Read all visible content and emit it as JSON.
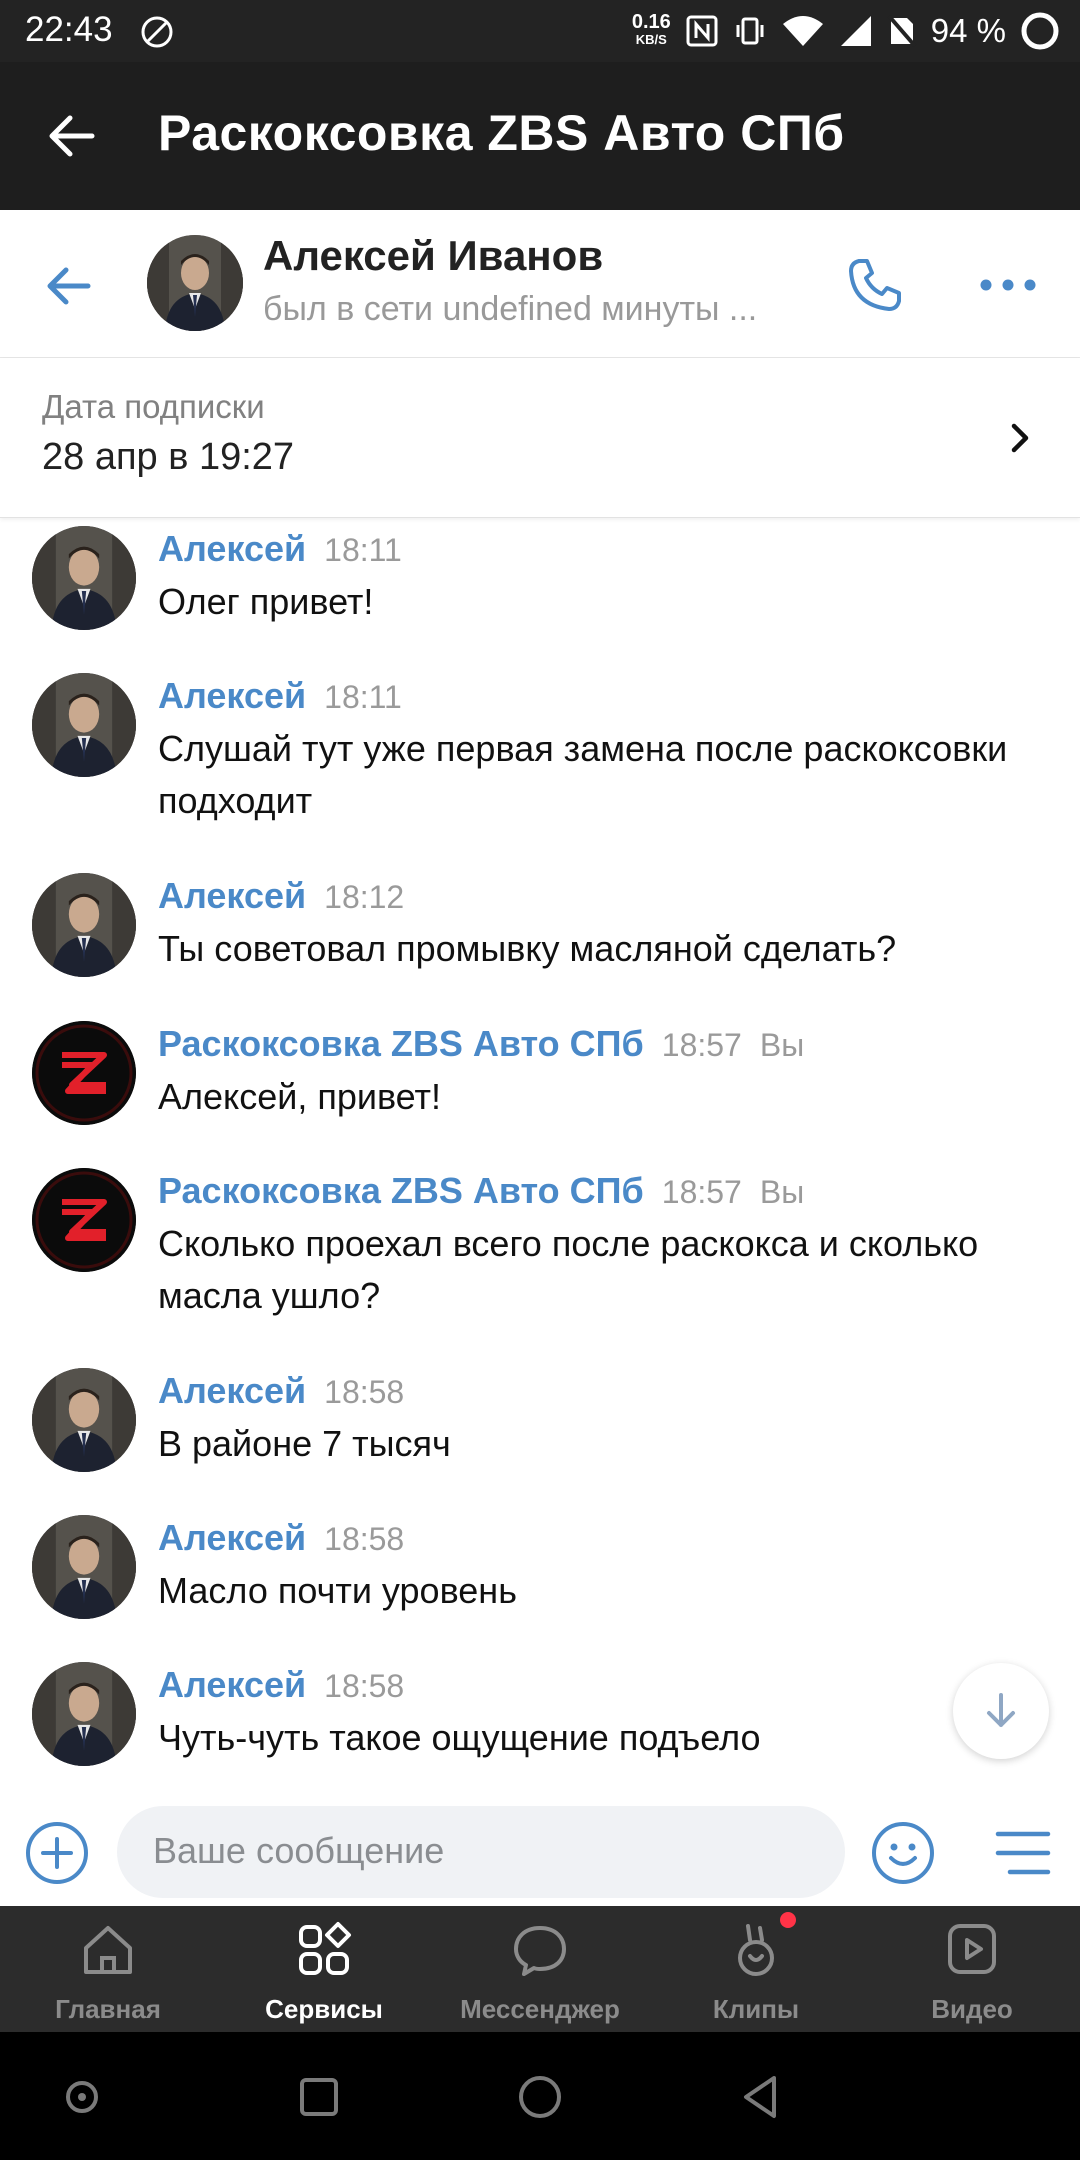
{
  "status_bar": {
    "time": "22:43",
    "net_speed": "0.16",
    "net_unit": "KB/S",
    "battery": "94 %"
  },
  "app_header": {
    "title": "Раскоксовка ZBS Авто СПб"
  },
  "chat_header": {
    "name": "Алексей Иванов",
    "status": "был в сети undefined минуты ..."
  },
  "subscription": {
    "label": "Дата подписки",
    "value": "28 апр в 19:27"
  },
  "messages": [
    {
      "author": "Алексей",
      "time": "18:11",
      "text": "Олег привет!",
      "you": ""
    },
    {
      "author": "Алексей",
      "time": "18:11",
      "text": "Слушай тут уже первая замена после раскоксовки подходит",
      "you": ""
    },
    {
      "author": "Алексей",
      "time": "18:12",
      "text": "Ты советовал промывку масляной сделать?",
      "you": ""
    },
    {
      "author": "Раскоксовка ZBS Авто СПб",
      "time": "18:57",
      "text": "Алексей, привет!",
      "you": "Вы"
    },
    {
      "author": "Раскоксовка ZBS Авто СПб",
      "time": "18:57",
      "text": "Сколько проехал всего после раскокса и сколько масла ушло?",
      "you": "Вы"
    },
    {
      "author": "Алексей",
      "time": "18:58",
      "text": "В районе 7 тысяч",
      "you": ""
    },
    {
      "author": "Алексей",
      "time": "18:58",
      "text": "Масло почти уровень",
      "you": ""
    },
    {
      "author": "Алексей",
      "time": "18:58",
      "text": "Чуть-чуть такое ощущение подъело",
      "you": ""
    }
  ],
  "input": {
    "placeholder": "Ваше сообщение"
  },
  "tabs": [
    {
      "label": "Главная",
      "icon": "home-icon"
    },
    {
      "label": "Сервисы",
      "icon": "services-icon"
    },
    {
      "label": "Мессенджер",
      "icon": "messenger-icon"
    },
    {
      "label": "Клипы",
      "icon": "clips-icon"
    },
    {
      "label": "Видео",
      "icon": "video-icon"
    }
  ],
  "colors": {
    "accent": "#4a89c8",
    "app_header_bg": "#1e1e1e",
    "tabbar_bg": "#2c2c2c",
    "badge": "#ff3347"
  }
}
